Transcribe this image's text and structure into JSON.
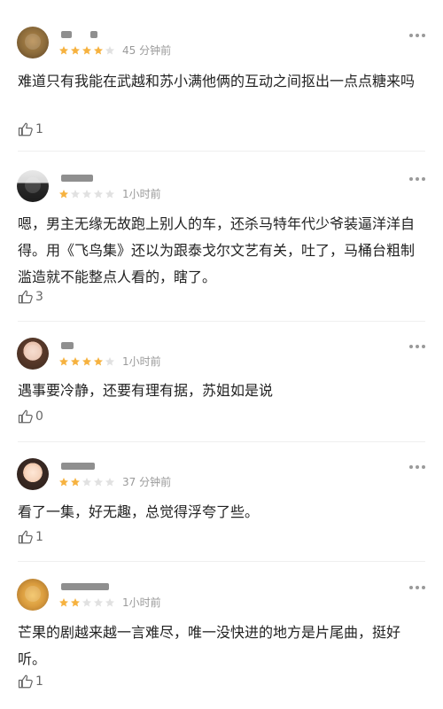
{
  "comments": [
    {
      "name": "",
      "rating": 4,
      "time": "45 分钟前",
      "text": "难道只有我能在武越和苏小满他俩的互动之间抠出一点点糖来吗",
      "likes": "1"
    },
    {
      "name": "",
      "rating": 1,
      "time": "1小时前",
      "text": "嗯，男主无缘无故跑上别人的车，还杀马特年代少爷装逼洋洋自得。用《飞鸟集》还以为跟泰戈尔文艺有关，吐了，马桶台粗制滥造就不能整点人看的，瞎了。",
      "likes": "3"
    },
    {
      "name": "",
      "rating": 4,
      "time": "1小时前",
      "text": "遇事要冷静，还要有理有据，苏姐如是说",
      "likes": "0"
    },
    {
      "name": "",
      "rating": 2,
      "time": "37 分钟前",
      "text": "看了一集，好无趣，总觉得浮夸了些。",
      "likes": "1"
    },
    {
      "name": "",
      "rating": 2,
      "time": "1小时前",
      "text": "芒果的剧越来越一言难尽，唯一没快进的地方是片尾曲，挺好听。",
      "likes": "1"
    }
  ],
  "colors": {
    "star_on": "#f6b23f",
    "star_off": "#e1e1e1",
    "meta_text": "#9a9a9a"
  }
}
